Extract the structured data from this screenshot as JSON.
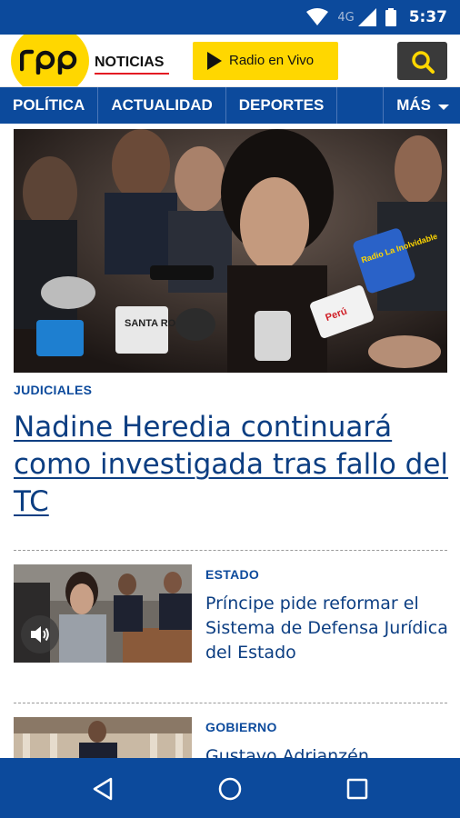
{
  "status_bar": {
    "network": "4G",
    "time": "5:37",
    "icons": [
      "wifi-icon",
      "cellular-signal-icon",
      "battery-icon"
    ]
  },
  "header": {
    "logo_text": "RPP",
    "brand_sub": "NOTICIAS",
    "radio_label": "Radio en Vivo",
    "search_icon": "search-icon",
    "colors": {
      "brand_yellow": "#ffd700",
      "brand_blue": "#0c4a9c",
      "accent_red": "#e31b23"
    }
  },
  "nav": {
    "items": [
      "POLÍTICA",
      "ACTUALIDAD",
      "DEPORTES"
    ],
    "more_label": "MÁS"
  },
  "hero": {
    "category": "JUDICIALES",
    "title": "Nadine Heredia continuará como investigada tras fallo del TC",
    "microphone_labels": [
      "SANTA ROSA",
      "Radio La Inolvidable",
      "Perú"
    ]
  },
  "articles": [
    {
      "category": "ESTADO",
      "title": "Príncipe pide reformar el Sistema de Defensa Jurídica del Estado",
      "has_audio": true
    },
    {
      "category": "GOBIERNO",
      "title": "Gustavo Adrianzén"
    }
  ],
  "system_nav": {
    "icons": [
      "back-icon",
      "home-icon",
      "recents-icon"
    ]
  }
}
